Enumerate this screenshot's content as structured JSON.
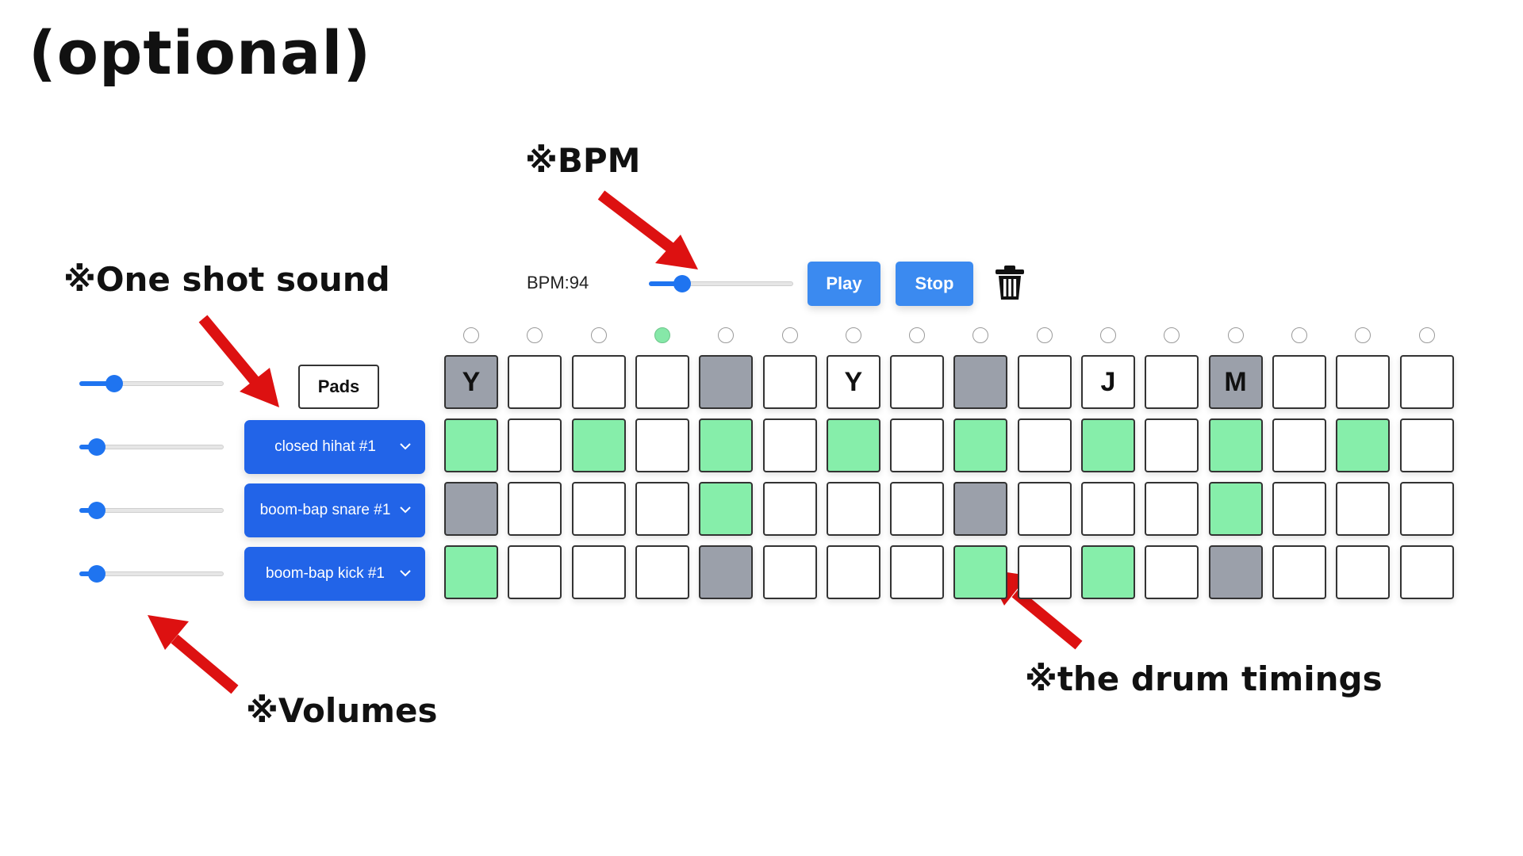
{
  "slide": {
    "title": "(optional)"
  },
  "annotations": {
    "bpm": "※BPM",
    "one_shot": "※One shot sound",
    "volumes": "※Volumes",
    "timings": "※the drum timings"
  },
  "controls": {
    "bpm_label": "BPM:94",
    "bpm_value": 94,
    "bpm_slider_fraction": 0.23,
    "play_label": "Play",
    "stop_label": "Stop",
    "pads_label": "Pads"
  },
  "tracks": [
    {
      "id": "pads",
      "volume": 0.24
    },
    {
      "id": "hihat",
      "sound": "closed hihat #1",
      "volume": 0.12
    },
    {
      "id": "snare",
      "sound": "boom-bap snare #1",
      "volume": 0.12
    },
    {
      "id": "kick",
      "sound": "boom-bap kick #1",
      "volume": 0.12
    }
  ],
  "sound_labels": [
    "closed hihat #1",
    "boom-bap snare #1",
    "boom-bap kick #1"
  ],
  "current_step": 3,
  "grid": [
    [
      {
        "s": "gray",
        "t": "Y"
      },
      {
        "s": "off",
        "t": ""
      },
      {
        "s": "off",
        "t": ""
      },
      {
        "s": "off",
        "t": ""
      },
      {
        "s": "gray",
        "t": ""
      },
      {
        "s": "off",
        "t": ""
      },
      {
        "s": "off",
        "t": "Y"
      },
      {
        "s": "off",
        "t": ""
      },
      {
        "s": "gray",
        "t": ""
      },
      {
        "s": "off",
        "t": ""
      },
      {
        "s": "off",
        "t": "J"
      },
      {
        "s": "off",
        "t": ""
      },
      {
        "s": "gray",
        "t": "M"
      },
      {
        "s": "off",
        "t": ""
      },
      {
        "s": "off",
        "t": ""
      },
      {
        "s": "off",
        "t": ""
      }
    ],
    [
      {
        "s": "green",
        "t": ""
      },
      {
        "s": "off",
        "t": ""
      },
      {
        "s": "green",
        "t": ""
      },
      {
        "s": "off",
        "t": ""
      },
      {
        "s": "green",
        "t": ""
      },
      {
        "s": "off",
        "t": ""
      },
      {
        "s": "green",
        "t": ""
      },
      {
        "s": "off",
        "t": ""
      },
      {
        "s": "green",
        "t": ""
      },
      {
        "s": "off",
        "t": ""
      },
      {
        "s": "green",
        "t": ""
      },
      {
        "s": "off",
        "t": ""
      },
      {
        "s": "green",
        "t": ""
      },
      {
        "s": "off",
        "t": ""
      },
      {
        "s": "green",
        "t": ""
      },
      {
        "s": "off",
        "t": ""
      }
    ],
    [
      {
        "s": "gray",
        "t": ""
      },
      {
        "s": "off",
        "t": ""
      },
      {
        "s": "off",
        "t": ""
      },
      {
        "s": "off",
        "t": ""
      },
      {
        "s": "green",
        "t": ""
      },
      {
        "s": "off",
        "t": ""
      },
      {
        "s": "off",
        "t": ""
      },
      {
        "s": "off",
        "t": ""
      },
      {
        "s": "gray",
        "t": ""
      },
      {
        "s": "off",
        "t": ""
      },
      {
        "s": "off",
        "t": ""
      },
      {
        "s": "off",
        "t": ""
      },
      {
        "s": "green",
        "t": ""
      },
      {
        "s": "off",
        "t": ""
      },
      {
        "s": "off",
        "t": ""
      },
      {
        "s": "off",
        "t": ""
      }
    ],
    [
      {
        "s": "green",
        "t": ""
      },
      {
        "s": "off",
        "t": ""
      },
      {
        "s": "off",
        "t": ""
      },
      {
        "s": "off",
        "t": ""
      },
      {
        "s": "gray",
        "t": ""
      },
      {
        "s": "off",
        "t": ""
      },
      {
        "s": "off",
        "t": ""
      },
      {
        "s": "off",
        "t": ""
      },
      {
        "s": "green",
        "t": ""
      },
      {
        "s": "off",
        "t": ""
      },
      {
        "s": "green",
        "t": ""
      },
      {
        "s": "off",
        "t": ""
      },
      {
        "s": "gray",
        "t": ""
      },
      {
        "s": "off",
        "t": ""
      },
      {
        "s": "off",
        "t": ""
      },
      {
        "s": "off",
        "t": ""
      }
    ]
  ],
  "colors": {
    "accent": "#1f74f0",
    "button": "#3b8af0",
    "select": "#2264e8",
    "step_on": "#86eeaa",
    "step_muted": "#9ba0aa",
    "arrow": "#dd1111"
  },
  "icons": {
    "trash": "trash-icon",
    "chevron": "chevron-down-icon",
    "arrow": "arrow-icon"
  }
}
